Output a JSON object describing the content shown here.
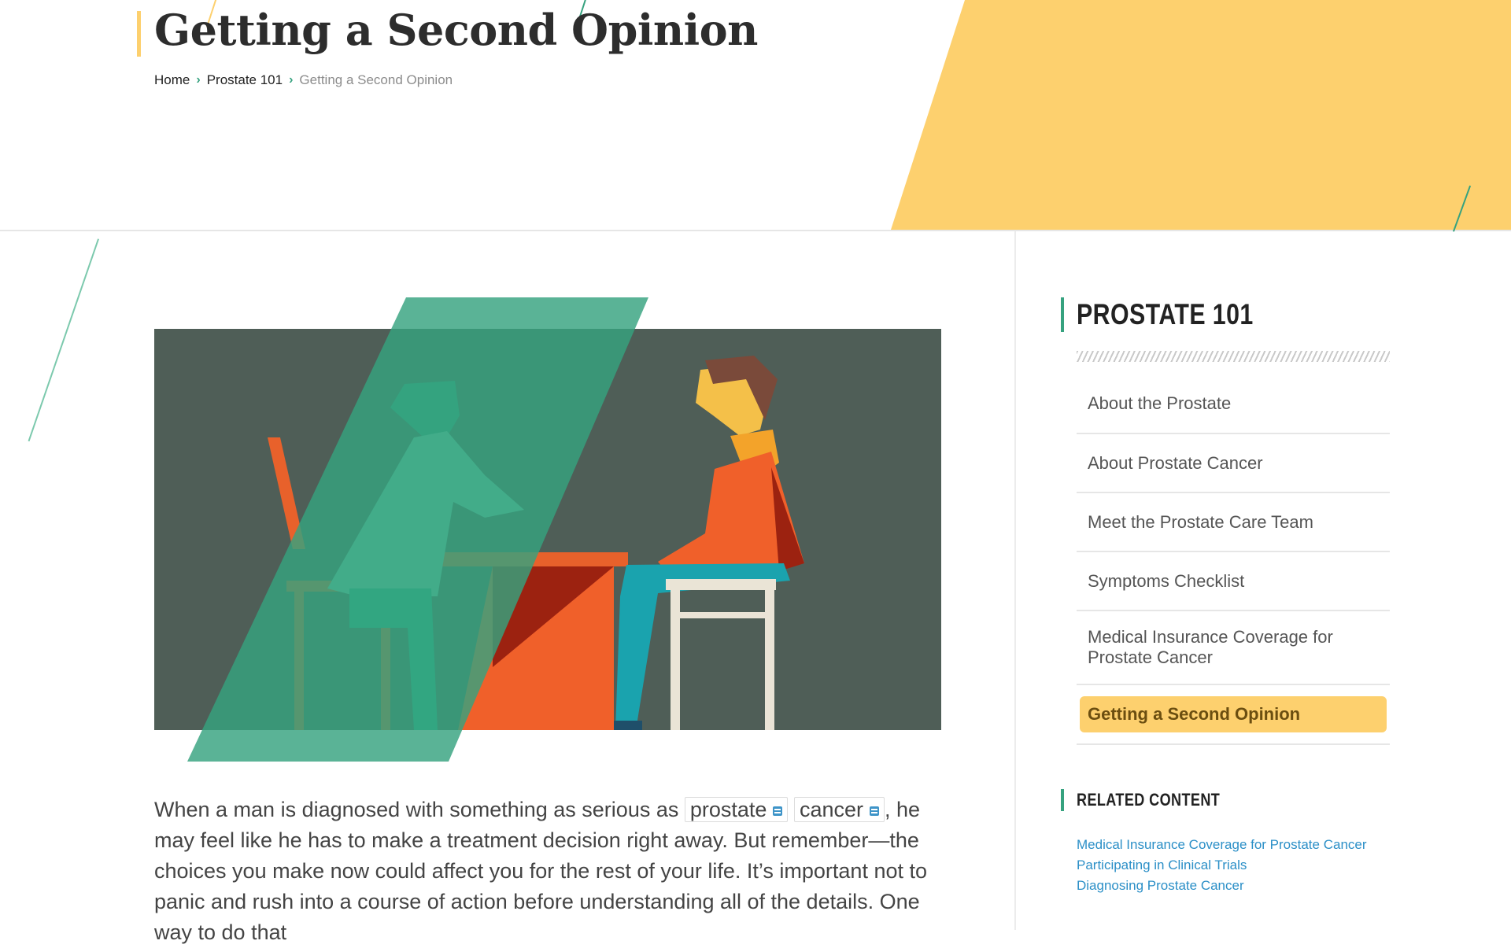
{
  "page": {
    "title": "Getting a Second Opinion"
  },
  "breadcrumb": {
    "items": [
      "Home",
      "Prostate 101",
      "Getting a Second Opinion"
    ]
  },
  "article": {
    "text_before": "When a man is diagnosed with something as serious as ",
    "tag1": "prostate",
    "tag2": "cancer",
    "text_after": ", he may feel like he has to make a treatment decision right away. But remember—the choices you make now could affect you for the rest of your life. It’s important not to panic and rush into a course of action before understanding all of the details. One way to do that"
  },
  "sidebar": {
    "title": "PROSTATE 101",
    "items": [
      "About the Prostate",
      "About Prostate Cancer",
      "Meet the Prostate Care Team",
      "Symptoms Checklist",
      "Medical Insurance Coverage for Prostate Cancer",
      "Getting a Second Opinion"
    ],
    "active_index": 5
  },
  "related": {
    "title": "RELATED CONTENT",
    "links": [
      "Medical Insurance Coverage for Prostate Cancer",
      "Participating in Clinical Trials",
      "Diagnosing Prostate Cancer"
    ]
  },
  "colors": {
    "accent_green": "#36a27f",
    "accent_yellow": "#fdd06e",
    "link_blue": "#2b8fc7",
    "illustration_bg": "#4f5e57"
  },
  "icons": {
    "glossary_tag": "glossary-calendar-icon",
    "breadcrumb_separator": "chevron-right-icon"
  }
}
